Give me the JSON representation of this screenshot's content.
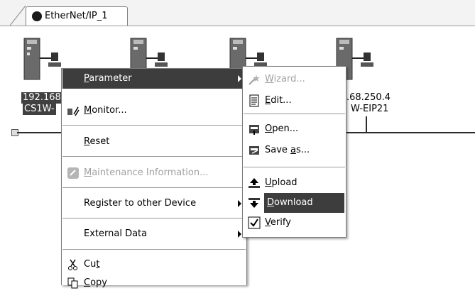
{
  "tab": {
    "label": "EtherNet/IP_1"
  },
  "devices": [
    {
      "ip_line": "192.168",
      "model_line": "CS1W-"
    },
    {
      "ip_line": ".68.250.4",
      "model_line": "W-EIP21"
    }
  ],
  "context_menu": {
    "items": [
      {
        "label_pre": "",
        "label_u": "P",
        "label_post": "arameter"
      },
      {
        "label_pre": "",
        "label_u": "M",
        "label_post": "onitor..."
      },
      {
        "label_pre": "",
        "label_u": "R",
        "label_post": "eset"
      },
      {
        "label_pre": "",
        "label_u": "M",
        "label_post": "aintenance Information..."
      },
      {
        "label": "Register to other Device"
      },
      {
        "label": "External Data"
      },
      {
        "label_pre": "Cu",
        "label_u": "t",
        "label_post": ""
      },
      {
        "label_pre": "",
        "label_u": "C",
        "label_post": "opy"
      }
    ]
  },
  "submenu": {
    "items": [
      {
        "label_pre": "",
        "label_u": "W",
        "label_post": "izard..."
      },
      {
        "label_pre": "",
        "label_u": "E",
        "label_post": "dit..."
      },
      {
        "label_pre": "",
        "label_u": "O",
        "label_post": "pen..."
      },
      {
        "label_pre": "Save ",
        "label_u": "a",
        "label_post": "s..."
      },
      {
        "label_pre": "",
        "label_u": "U",
        "label_post": "pload"
      },
      {
        "label_pre": "",
        "label_u": "D",
        "label_post": "ownload"
      },
      {
        "label_pre": "",
        "label_u": "V",
        "label_post": "erify"
      }
    ]
  },
  "colors": {
    "highlight": "#3d3d3d",
    "disabled_text": "#a0a0a0"
  }
}
